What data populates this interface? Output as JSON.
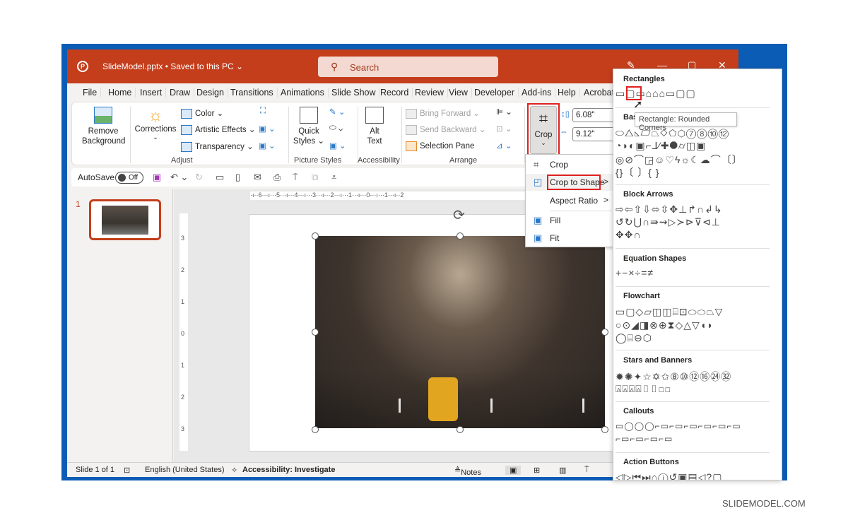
{
  "app": {
    "file_title": "SlideModel.pptx • Saved to this PC ⌄",
    "search_placeholder": "Search",
    "search_icon": "search-icon",
    "window_controls": [
      "pen-icon",
      "minimize",
      "restore",
      "close"
    ]
  },
  "tabs": [
    "File",
    "Home",
    "Insert",
    "Draw",
    "Design",
    "Transitions",
    "Animations",
    "Slide Show",
    "Record",
    "Review",
    "View",
    "Developer",
    "Add-ins",
    "Help",
    "Acrobat"
  ],
  "ribbon": {
    "remove_bg": "Remove Background",
    "corrections": "Corrections",
    "color": "Color ⌄",
    "artistic": "Artistic Effects ⌄",
    "transparency": "Transparency ⌄",
    "adjust_group": "Adjust",
    "quick_styles": "Quick Styles ⌄",
    "picture_styles_group": "Picture Styles",
    "alt_text": "Alt Text",
    "accessibility_group": "Accessibility",
    "bring_forward": "Bring Forward",
    "send_backward": "Send Backward",
    "selection_pane": "Selection Pane",
    "arrange_group": "Arrange",
    "crop": "Crop",
    "height": "6.08\"",
    "width": "9.12\""
  },
  "qat": {
    "autosave": "AutoSave",
    "toggle": "Off"
  },
  "thumbs": {
    "number": "1"
  },
  "ruler": {
    "h": "·ı··6···ı···5···ı···4···ı···3···ı···2···ı···1···ı···0···ı···1···ı··2",
    "v": [
      "3",
      "2",
      "1",
      "0",
      "1",
      "2",
      "3"
    ]
  },
  "crop_menu": [
    {
      "label": "Crop",
      "icon": "crop-icon",
      "arrow": ""
    },
    {
      "label": "Crop to Shape",
      "icon": "crop-shape-icon",
      "arrow": ">"
    },
    {
      "label": "Aspect Ratio",
      "icon": "",
      "arrow": ">"
    },
    {
      "label": "Fill",
      "icon": "fill-icon",
      "arrow": ""
    },
    {
      "label": "Fit",
      "icon": "fit-icon",
      "arrow": ""
    }
  ],
  "shapes": {
    "sections": [
      {
        "title": "Rectangles",
        "rows": [
          "▭▢▭⌂⌂⌂▭▢▢"
        ]
      },
      {
        "title": "Basic Shapes",
        "rows": [
          "⬭△◺▱⏢◇⬠⬡⑦⑧⑩⑫",
          "◔◗◐▣⌐⅃⁄✚⯃⌭◫▣",
          "◎⊘⌒◲☺♡ϟ☼☾☁⌒〔〕",
          "{}〔 〕{ }"
        ]
      },
      {
        "title": "Block Arrows",
        "rows": [
          "⇨⇦⇧⇩⬄⇳✥⊥↱∩↲↳",
          "↺↻⋃∩⇛⇝▷≻⊳⊽⊲⊥",
          "✥✥∩"
        ]
      },
      {
        "title": "Equation Shapes",
        "rows": [
          "+−×÷=≠"
        ]
      },
      {
        "title": "Flowchart",
        "rows": [
          "▭▢◇▱◫◫⌸⊡⬭⬭⏢▽",
          "○⊙◢◨⊗⊕⧗◇△▽◖◗",
          "◯⌸⊖⬡"
        ]
      },
      {
        "title": "Stars and Banners",
        "rows": [
          "✹✺✦☆✡✩⑧⑩⑫⑯㉔㉜",
          "⍓⍓⍓⍓▯▯◻◻"
        ]
      },
      {
        "title": "Callouts",
        "rows": [
          "▭◯◯◯⌐▭⌐▭⌐▭⌐▭⌐▭⌐▭",
          "⌐▭⌐▭⌐▭⌐▭"
        ]
      },
      {
        "title": "Action Buttons",
        "rows": [
          "◁▷⏮⏭⌂ⓘ↺▣▤◁?▢"
        ]
      }
    ],
    "tooltip": "Rectangle: Rounded Corners"
  },
  "status": {
    "slide": "Slide 1 of 1",
    "lang": "English (United States)",
    "acc": "Accessibility: Investigate",
    "notes": "Notes"
  },
  "watermark": "SLIDEMODEL.COM"
}
